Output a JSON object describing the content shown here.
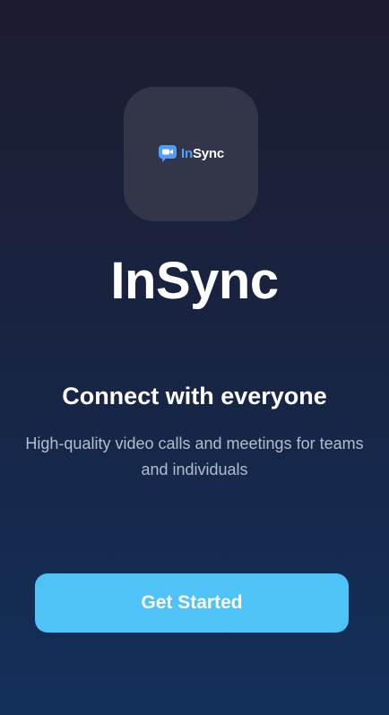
{
  "logo": {
    "icon": "video-chat-icon",
    "word_accent": "In",
    "word_rest": "Sync",
    "accent_color": "#4f9dff"
  },
  "app_name": "InSync",
  "headline": "Connect with everyone",
  "description": "High-quality video calls and meetings for teams and individuals",
  "cta": {
    "label": "Get Started",
    "color": "#4fc3f7"
  },
  "background": {
    "top": "#1c1c2f",
    "bottom": "#13305b"
  }
}
